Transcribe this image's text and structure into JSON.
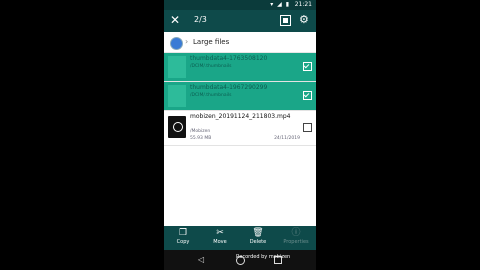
{
  "status": {
    "time": "21:21",
    "icons": "▾ ◢ ▮"
  },
  "appbar": {
    "close_icon": "✕",
    "selection_count": "2/3",
    "settings_icon": "⚙"
  },
  "breadcrumb": {
    "label": "Large files",
    "chevron": "›"
  },
  "files": [
    {
      "name": "thumbdata4-1763508120",
      "path": "/DCIM/.thumbnails",
      "size": "",
      "date": "",
      "selected": true
    },
    {
      "name": "thumbdata4-1967290299",
      "path": "/DCIM/.thumbnails",
      "size": "",
      "date": "",
      "selected": true
    },
    {
      "name": "mobizen_20191124_211803.mp4",
      "path": "/Mobizen",
      "size": "55.93 MB",
      "date": "24/11/2019",
      "selected": false
    }
  ],
  "bottombar": {
    "copy": {
      "label": "Copy",
      "icon": "❐"
    },
    "move": {
      "label": "Move",
      "icon": "✂"
    },
    "delete": {
      "label": "Delete",
      "icon": "🗑"
    },
    "properties": {
      "label": "Properties",
      "icon": "ⓘ"
    }
  },
  "navbar": {
    "back_icon": "◁"
  },
  "watermark": "Recorded by mobizen"
}
